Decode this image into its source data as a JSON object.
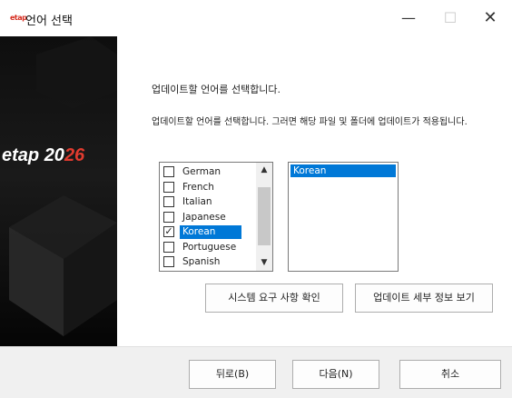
{
  "window": {
    "logo_text": "etap",
    "title": "언어 선택",
    "minimize_glyph": "—",
    "maximize_glyph": "☐",
    "close_glyph": "✕"
  },
  "sidebar": {
    "brand_name": "etap",
    "brand_year_prefix": "20",
    "brand_year_accent": "26",
    "brand_accent_color": "#e03b2f"
  },
  "main": {
    "heading": "업데이트할 언어를 선택합니다.",
    "description": "업데이트할 언어를 선택합니다. 그러면 해당 파일 및 폴더에 업데이트가 적용됩니다.",
    "languages": [
      {
        "label": "German",
        "checked": false,
        "selected": false
      },
      {
        "label": "French",
        "checked": false,
        "selected": false
      },
      {
        "label": "Italian",
        "checked": false,
        "selected": false
      },
      {
        "label": "Japanese",
        "checked": false,
        "selected": false
      },
      {
        "label": "Korean",
        "checked": true,
        "selected": true
      },
      {
        "label": "Portuguese",
        "checked": false,
        "selected": false
      },
      {
        "label": "Spanish",
        "checked": false,
        "selected": false
      }
    ],
    "scroll_up_glyph": "▲",
    "scroll_down_glyph": "▼",
    "check_glyph": "✓",
    "selected_languages": [
      "Korean"
    ],
    "requirements_button": "시스템 요구 사항 확인",
    "details_button": "업데이트 세부 정보 보기"
  },
  "footer": {
    "back_label": "뒤로(B)",
    "next_label": "다음(N)",
    "cancel_label": "취소"
  },
  "colors": {
    "selection": "#0078d7",
    "brand_red": "#d62d20"
  }
}
